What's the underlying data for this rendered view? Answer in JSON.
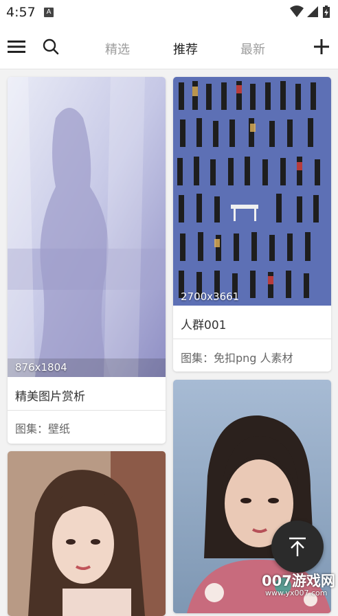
{
  "status_bar": {
    "time": "4:57",
    "notification_badge": "A",
    "icons": [
      "wifi-icon",
      "signal-icon",
      "battery-icon"
    ]
  },
  "header": {
    "tabs": [
      {
        "label": "精选",
        "active": false
      },
      {
        "label": "推荐",
        "active": true
      },
      {
        "label": "最新",
        "active": false
      }
    ],
    "icons": [
      "menu-icon",
      "search-icon",
      "add-icon"
    ]
  },
  "cards": [
    {
      "dimensions": "876x1804",
      "title": "精美图片赏析",
      "album": "图集：壁纸"
    },
    {
      "dimensions": "2700x3661",
      "title": "人群001",
      "album": "图集：免扣png 人素材"
    },
    {
      "dimensions": "",
      "title": "",
      "album": ""
    },
    {
      "dimensions": "",
      "title": "",
      "album": ""
    }
  ],
  "fab": {
    "icon": "scroll-to-top-icon"
  },
  "watermark": {
    "text": "007游戏网",
    "url": "www.yx007.com"
  },
  "colors": {
    "active_tab": "#222222",
    "inactive_tab": "#9c9c9c",
    "background": "#f2f2f2",
    "fab": "#2b2b2b"
  }
}
